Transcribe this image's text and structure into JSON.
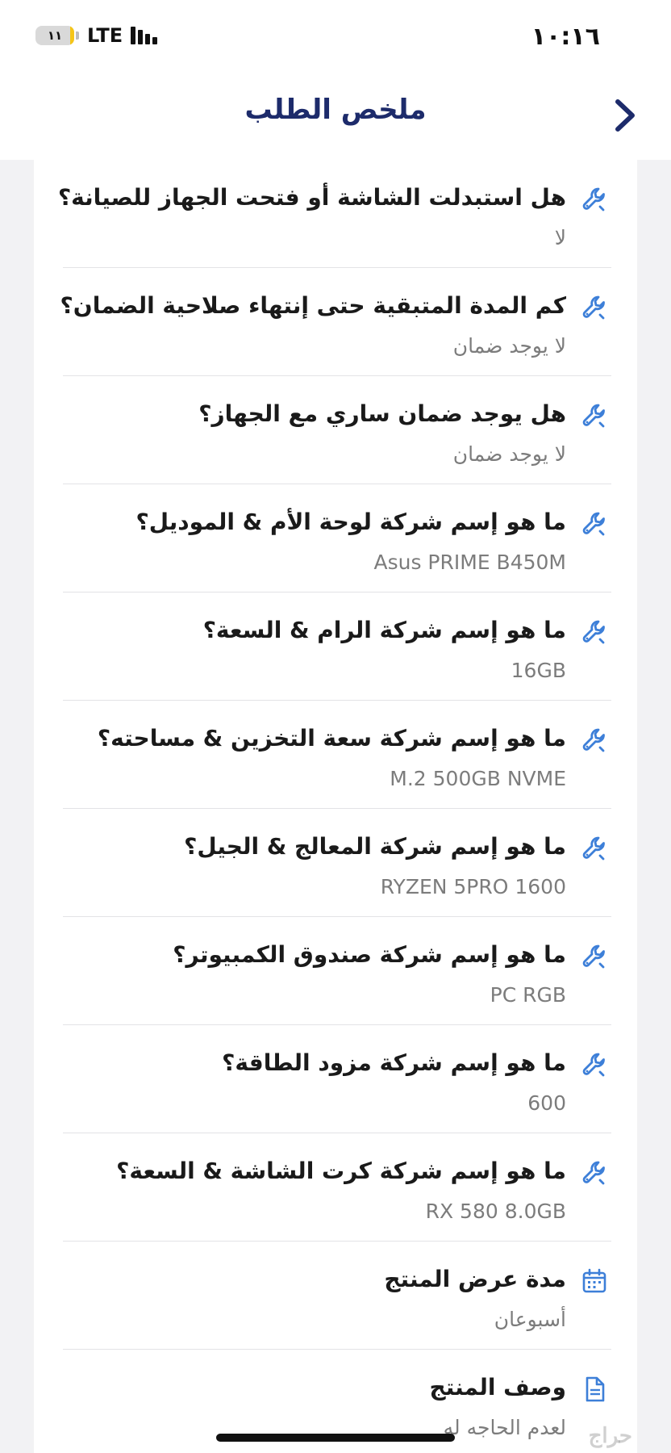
{
  "status_bar": {
    "time": "١٠:١٦",
    "battery_level": "١١",
    "battery_percent": 11,
    "network": "LTE"
  },
  "header": {
    "title": "ملخص الطلب"
  },
  "items": [
    {
      "question": "هل استبدلت الشاشة أو فتحت الجهاز للصيانة؟",
      "answer": "لا",
      "icon": "wrench-icon"
    },
    {
      "question": "كم المدة المتبقية حتى إنتهاء صلاحية الضمان؟",
      "answer": "لا يوجد ضمان",
      "icon": "wrench-icon"
    },
    {
      "question": "هل يوجد ضمان ساري مع الجهاز؟",
      "answer": "لا يوجد ضمان",
      "icon": "wrench-icon"
    },
    {
      "question": "ما هو إسم شركة لوحة الأم & الموديل؟",
      "answer": "Asus PRIME B450M",
      "icon": "wrench-icon"
    },
    {
      "question": "ما هو إسم شركة الرام & السعة؟",
      "answer": "16GB",
      "icon": "wrench-icon"
    },
    {
      "question": "ما هو إسم شركة سعة التخزين & مساحته؟",
      "answer": "M.2 500GB NVME",
      "icon": "wrench-icon"
    },
    {
      "question": "ما هو إسم شركة المعالج & الجيل؟",
      "answer": "RYZEN 5PRO 1600",
      "icon": "wrench-icon"
    },
    {
      "question": "ما هو إسم شركة صندوق الكمبيوتر؟",
      "answer": "PC RGB",
      "icon": "wrench-icon"
    },
    {
      "question": "ما هو إسم شركة مزود الطاقة؟",
      "answer": "600",
      "icon": "wrench-icon"
    },
    {
      "question": "ما هو إسم شركة كرت الشاشة & السعة؟",
      "answer": "RX 580 8.0GB",
      "icon": "wrench-icon"
    },
    {
      "question": "مدة عرض المنتج",
      "answer": "أسبوعان",
      "icon": "calendar-icon"
    },
    {
      "question": "وصف المنتج",
      "answer": "لعدم الحاجه له",
      "icon": "document-icon"
    }
  ],
  "watermark": "حراج",
  "colors": {
    "header_title": "#1d2b6b",
    "icon_blue": "#3d7fd8",
    "battery_fill": "#f5c518"
  }
}
